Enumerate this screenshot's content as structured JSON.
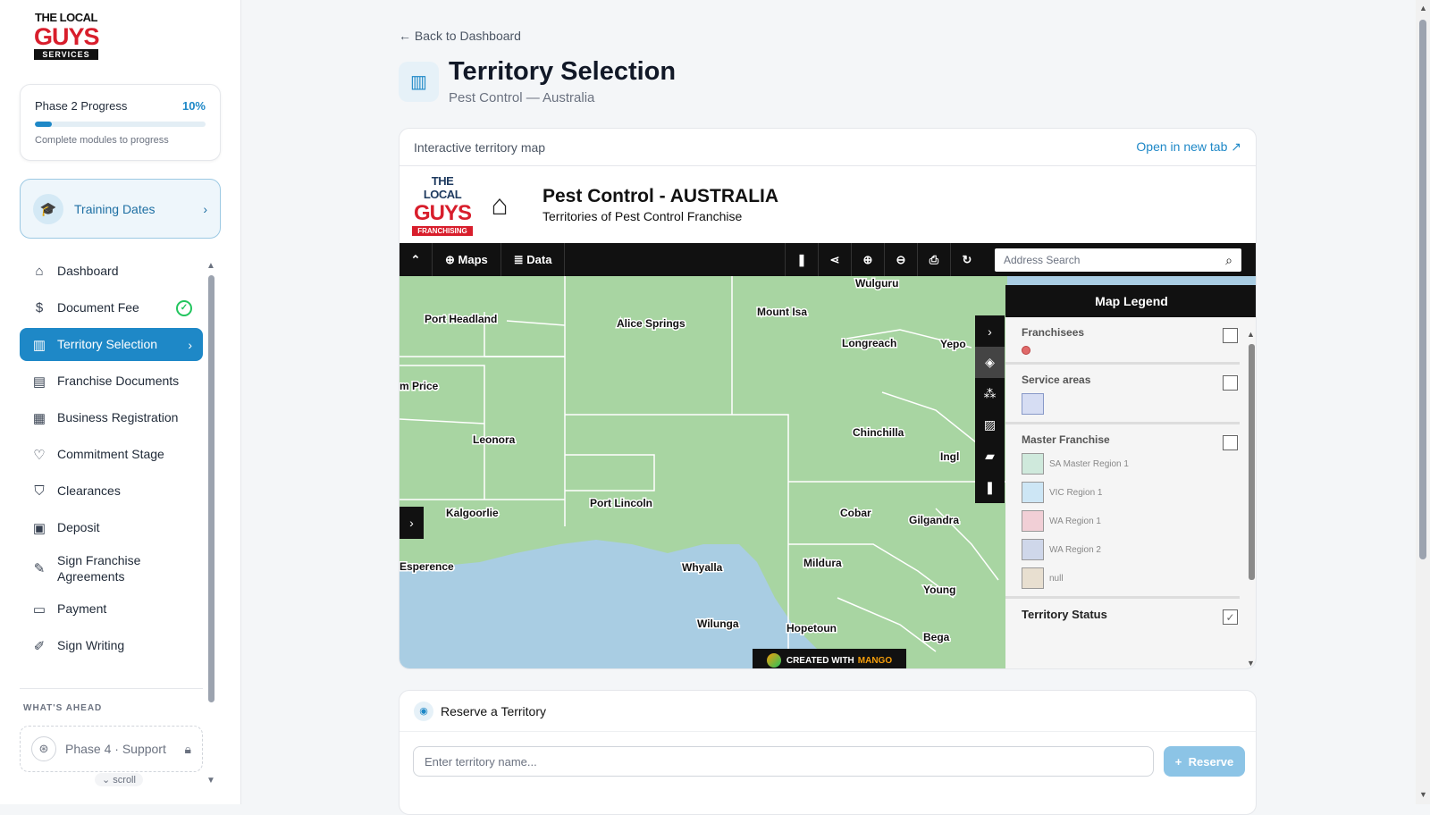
{
  "logo": {
    "line1": "THE LOCAL",
    "line2": "GUYS",
    "line3": "SERVICES"
  },
  "progress": {
    "label": "Phase 2 Progress",
    "percent_text": "10%",
    "value": 0.1,
    "note": "Complete modules to progress"
  },
  "training": {
    "label": "Training Dates"
  },
  "nav": [
    {
      "label": "Dashboard",
      "icon": "home-icon"
    },
    {
      "label": "Document Fee",
      "icon": "dollar-icon",
      "done": true
    },
    {
      "label": "Territory Selection",
      "icon": "map-icon",
      "active": true
    },
    {
      "label": "Franchise Documents",
      "icon": "document-icon"
    },
    {
      "label": "Business Registration",
      "icon": "building-icon"
    },
    {
      "label": "Commitment Stage",
      "icon": "handshake-icon"
    },
    {
      "label": "Clearances",
      "icon": "shield-icon"
    },
    {
      "label": "Deposit",
      "icon": "wallet-icon"
    },
    {
      "label": "Sign Franchise Agreements",
      "icon": "pen-document-icon"
    },
    {
      "label": "Payment",
      "icon": "card-icon"
    },
    {
      "label": "Sign Writing",
      "icon": "brush-icon"
    }
  ],
  "ahead": {
    "heading": "WHAT'S AHEAD",
    "phase4": "Phase 4 · Support",
    "scroll_hint": "scroll"
  },
  "header": {
    "back": "Back to Dashboard",
    "title": "Territory Selection",
    "subtitle": "Pest Control — Australia"
  },
  "map_card": {
    "label": "Interactive territory map",
    "open_link": "Open in new tab",
    "brand": {
      "line1": "THE LOCAL",
      "line2": "GUYS",
      "line3": "FRANCHISING"
    },
    "map_title": "Pest Control - AUSTRALIA",
    "map_subtitle": "Territories of Pest Control Franchise",
    "toolbar": {
      "maps": "Maps",
      "data": "Data"
    },
    "search_placeholder": "Address Search",
    "places": [
      {
        "name": "Port Headland"
      },
      {
        "name": "Alice Springs"
      },
      {
        "name": "Mount Isa"
      },
      {
        "name": "Wulguru"
      },
      {
        "name": "Longreach"
      },
      {
        "name": "Yepo"
      },
      {
        "name": "m Price"
      },
      {
        "name": "Leonora"
      },
      {
        "name": "Chinchilla"
      },
      {
        "name": "Ingl"
      },
      {
        "name": "Kalgoorlie"
      },
      {
        "name": "Port Lincoln"
      },
      {
        "name": "Cobar"
      },
      {
        "name": "Gilgandra"
      },
      {
        "name": "Esperence"
      },
      {
        "name": "Whyalla"
      },
      {
        "name": "Mildura"
      },
      {
        "name": "Young"
      },
      {
        "name": "Wilunga"
      },
      {
        "name": "Hopetoun"
      },
      {
        "name": "Bega"
      }
    ],
    "credit": {
      "prefix": "CREATED WITH",
      "brand": "MANGO"
    },
    "legend": {
      "title": "Map Legend",
      "franchisees": "Franchisees",
      "service_areas": "Service areas",
      "master_franchise": "Master Franchise",
      "regions": [
        {
          "name": "SA Master Region 1",
          "color": "#cfe9dc"
        },
        {
          "name": "VIC Region 1",
          "color": "#cde6f5"
        },
        {
          "name": "WA Region 1",
          "color": "#f1cfd6"
        },
        {
          "name": "WA Region 2",
          "color": "#cfd7ea"
        },
        {
          "name": "null",
          "color": "#e8dfd0"
        }
      ],
      "territory_status": "Territory Status"
    }
  },
  "reserve": {
    "title": "Reserve a Territory",
    "placeholder": "Enter territory name...",
    "button": "Reserve"
  },
  "colors": {
    "accent": "#1e88c7",
    "map_land": "#a8d5a2",
    "map_water": "#a9cde3"
  }
}
